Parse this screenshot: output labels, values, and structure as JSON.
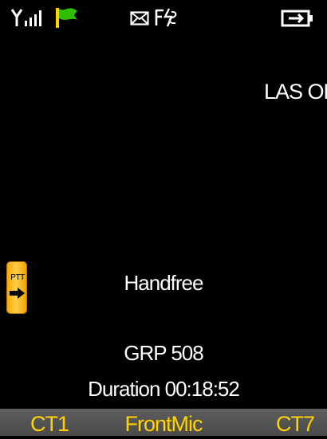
{
  "status_bar": {
    "icons": [
      "signal-icon",
      "flag-icon",
      "mail-icon",
      "fs-icon",
      "battery-icon"
    ],
    "flag_color": "#2fbf00"
  },
  "main": {
    "network_text": "LAS ON",
    "ptt_label": "PTT",
    "mode_text": "Handfree",
    "group_text": "GRP 508",
    "duration_text": "Duration 00:18:52"
  },
  "softkeys": {
    "left": "CT1",
    "center": "FrontMic",
    "right": "CT7"
  },
  "colors": {
    "background": "#000000",
    "text": "#ffffff",
    "softkey_text": "#ffd200",
    "softkey_bar": "#555555",
    "ptt_tab": "#ffc21a"
  }
}
